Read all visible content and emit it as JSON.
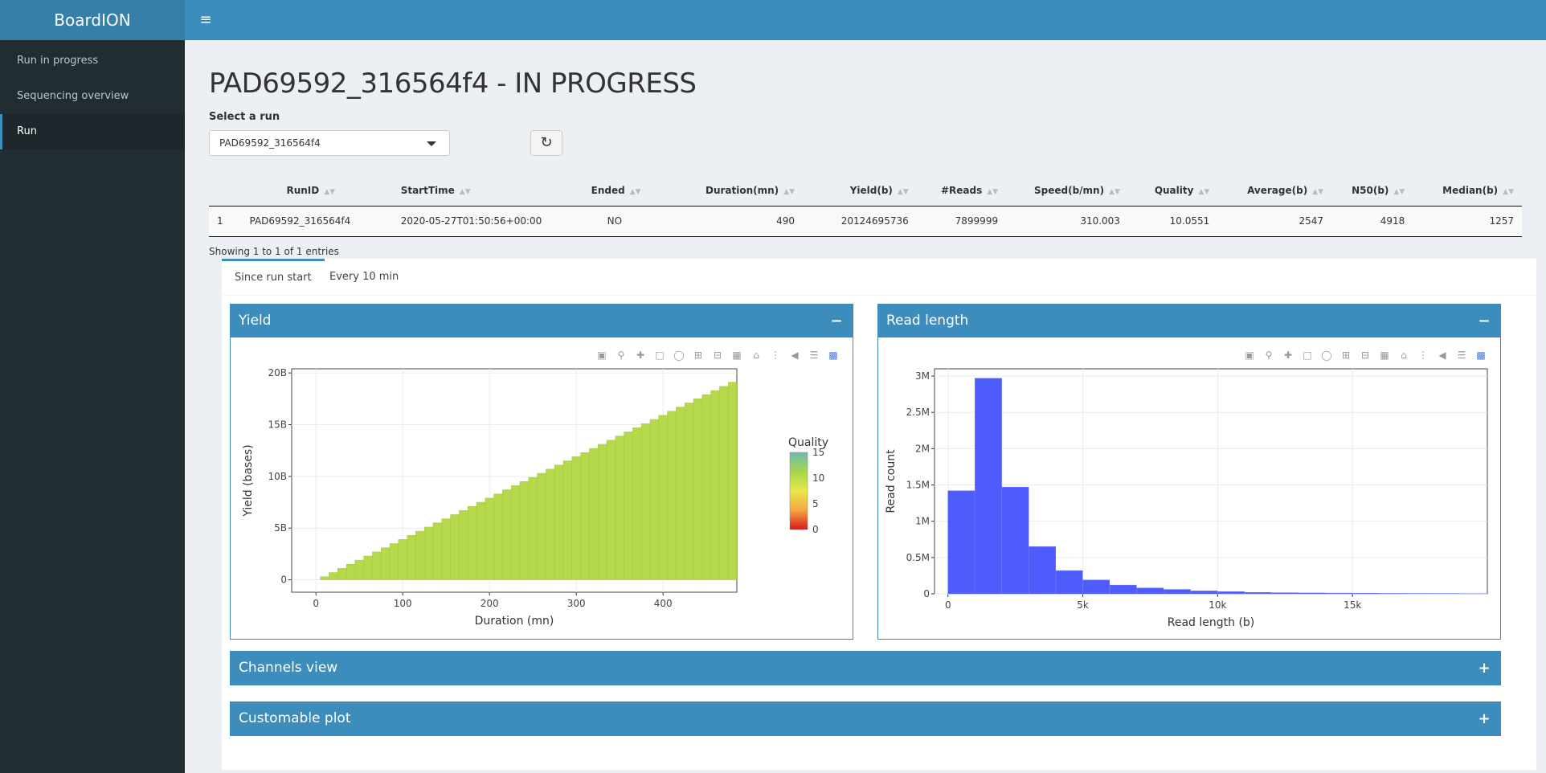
{
  "app": {
    "title": "BoardION"
  },
  "sidebar": {
    "items": [
      {
        "label": "Run in progress"
      },
      {
        "label": "Sequencing overview"
      },
      {
        "label": "Run"
      }
    ]
  },
  "topbar": {
    "menu_icon": "hamburger-icon"
  },
  "page": {
    "title": "PAD69592_316564f4 - IN PROGRESS",
    "select_label": "Select a run",
    "selected_run": "PAD69592_316564f4",
    "refresh_icon": "refresh-icon"
  },
  "table": {
    "headers": [
      "",
      "RunID",
      "StartTime",
      "Ended",
      "Duration(mn)",
      "Yield(b)",
      "#Reads",
      "Speed(b/mn)",
      "Quality",
      "Average(b)",
      "N50(b)",
      "Median(b)"
    ],
    "rows": [
      [
        "1",
        "PAD69592_316564f4",
        "2020-05-27T01:50:56+00:00",
        "NO",
        "490",
        "20124695736",
        "7899999",
        "310.003",
        "10.0551",
        "2547",
        "4918",
        "1257"
      ]
    ],
    "info": "Showing 1 to 1 of 1 entries"
  },
  "tabs": [
    {
      "label": "Since run start"
    },
    {
      "label": "Every 10 min"
    }
  ],
  "boxes": {
    "yield": {
      "title": "Yield",
      "collapse": "−"
    },
    "read_length": {
      "title": "Read length",
      "collapse": "−"
    },
    "channels": {
      "title": "Channels view",
      "expand": "+"
    },
    "custom": {
      "title": "Customable plot",
      "expand": "+"
    }
  },
  "colors": {
    "accent": "#3c8dbc",
    "sidebar": "#222d32",
    "yield_bar": "#b5d94a",
    "histogram_bar": "#4e5cfb"
  },
  "chart_data": [
    {
      "type": "bar",
      "xlabel": "Duration (mn)",
      "ylabel": "Yield (bases)",
      "x_ticks": [
        "0",
        "100",
        "200",
        "300",
        "400"
      ],
      "y_ticks": [
        "0",
        "5B",
        "10B",
        "15B",
        "20B"
      ],
      "xlim": [
        -28,
        485
      ],
      "ylim": [
        -1.2,
        20.4
      ],
      "bar_width": 10,
      "x": [
        10,
        20,
        30,
        40,
        50,
        60,
        70,
        80,
        90,
        100,
        110,
        120,
        130,
        140,
        150,
        160,
        170,
        180,
        190,
        200,
        210,
        220,
        230,
        240,
        250,
        260,
        270,
        280,
        290,
        300,
        310,
        320,
        330,
        340,
        350,
        360,
        370,
        380,
        390,
        400,
        410,
        420,
        430,
        440,
        450,
        460,
        470,
        480
      ],
      "values": [
        0.3,
        0.7,
        1.1,
        1.5,
        1.9,
        2.3,
        2.7,
        3.1,
        3.5,
        3.9,
        4.3,
        4.7,
        5.1,
        5.5,
        5.9,
        6.3,
        6.7,
        7.1,
        7.5,
        7.9,
        8.3,
        8.7,
        9.1,
        9.5,
        9.9,
        10.3,
        10.7,
        11.1,
        11.5,
        11.9,
        12.3,
        12.7,
        13.1,
        13.5,
        13.9,
        14.3,
        14.7,
        15.1,
        15.5,
        15.9,
        16.3,
        16.7,
        17.1,
        17.5,
        17.9,
        18.3,
        18.7,
        19.1
      ],
      "color_scale": {
        "title": "Quality",
        "ticks": [
          "0",
          "5",
          "10",
          "15"
        ],
        "colors": [
          "#d7191c",
          "#f4a742",
          "#e8e84a",
          "#a7d54b",
          "#6fb9b3"
        ]
      }
    },
    {
      "type": "bar",
      "xlabel": "Read length (b)",
      "ylabel": "Read count",
      "x_ticks": [
        "0",
        "5k",
        "10k",
        "15k"
      ],
      "y_ticks": [
        "0",
        "0.5M",
        "1M",
        "1.5M",
        "2M",
        "2.5M",
        "3M"
      ],
      "xlim": [
        -500,
        20000
      ],
      "ylim": [
        0,
        3.1
      ],
      "bar_width": 1000,
      "x": [
        0,
        1000,
        2000,
        3000,
        4000,
        5000,
        6000,
        7000,
        8000,
        9000,
        10000,
        11000,
        12000,
        13000,
        14000,
        15000,
        16000,
        17000,
        18000,
        19000
      ],
      "values": [
        1.42,
        2.97,
        1.47,
        0.65,
        0.32,
        0.19,
        0.12,
        0.08,
        0.06,
        0.04,
        0.03,
        0.02,
        0.015,
        0.012,
        0.01,
        0.008,
        0.006,
        0.005,
        0.004,
        0.003
      ]
    }
  ]
}
